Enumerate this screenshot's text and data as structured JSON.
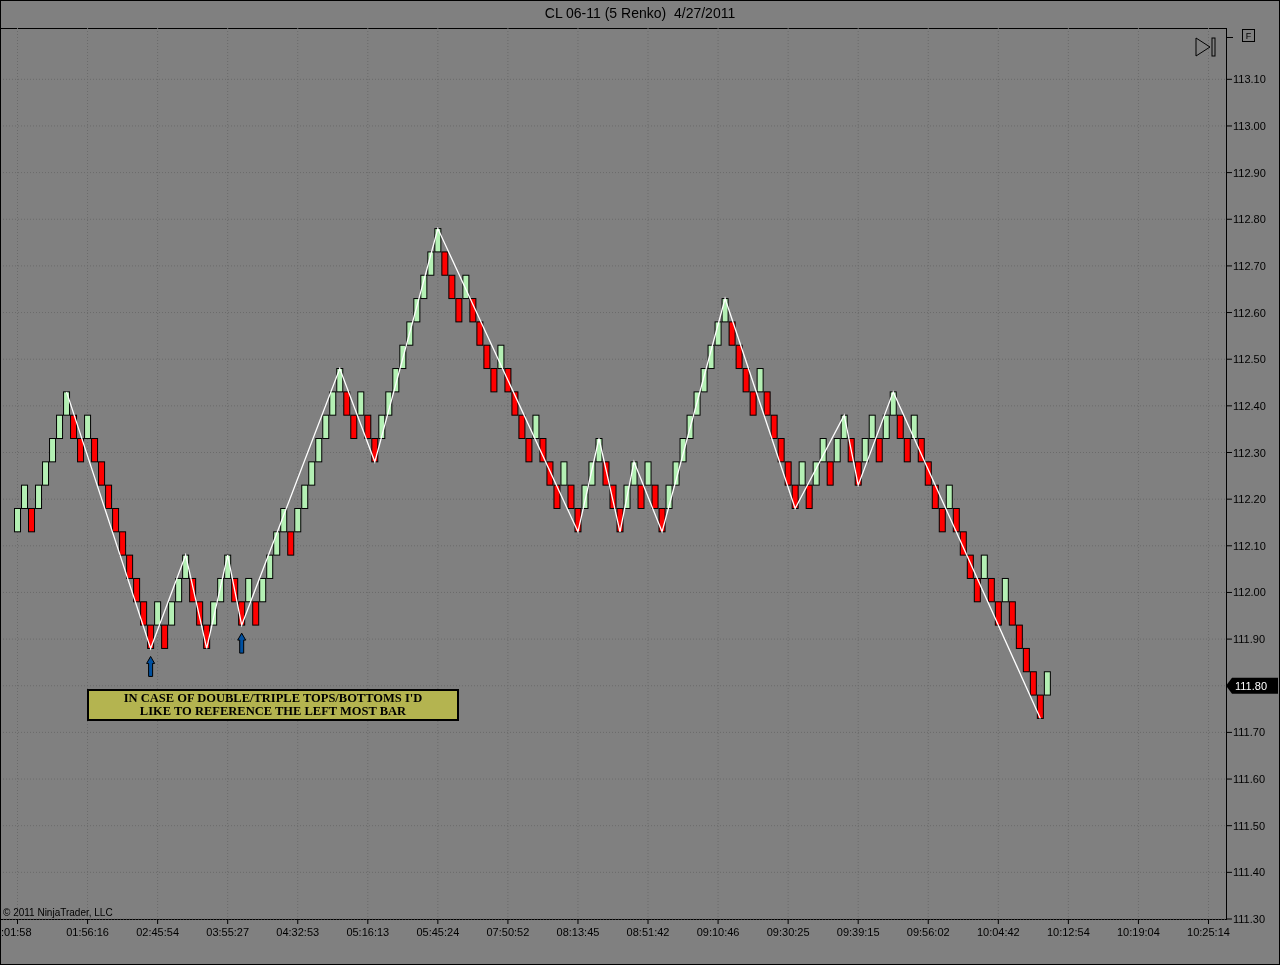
{
  "copyright": "© 2011 NinjaTrader, LLC",
  "toolbar": {
    "f_button": "F"
  },
  "note": "IN CASE OF DOUBLE/TRIPLE TOPS/BOTTOMS I'D LIKE TO REFERENCE THE LEFT MOST BAR",
  "last_price_label": "111.80",
  "renko_bricks": [
    {
      "kind": "gap"
    },
    {
      "kind": "gap"
    },
    {
      "kind": "up"
    },
    {
      "kind": "up"
    },
    {
      "kind": "down"
    },
    {
      "kind": "up"
    },
    {
      "kind": "up"
    },
    {
      "kind": "up"
    },
    {
      "kind": "up"
    },
    {
      "kind": "up"
    },
    {
      "kind": "down"
    },
    {
      "kind": "down"
    },
    {
      "kind": "up"
    },
    {
      "kind": "down"
    },
    {
      "kind": "down"
    },
    {
      "kind": "down"
    },
    {
      "kind": "down"
    },
    {
      "kind": "down"
    },
    {
      "kind": "down"
    },
    {
      "kind": "down"
    },
    {
      "kind": "down"
    },
    {
      "kind": "down"
    },
    {
      "kind": "up"
    },
    {
      "kind": "down"
    },
    {
      "kind": "up"
    },
    {
      "kind": "up"
    },
    {
      "kind": "up"
    },
    {
      "kind": "down"
    },
    {
      "kind": "down"
    },
    {
      "kind": "down"
    },
    {
      "kind": "up"
    },
    {
      "kind": "up"
    },
    {
      "kind": "up"
    },
    {
      "kind": "down"
    },
    {
      "kind": "down"
    },
    {
      "kind": "up"
    },
    {
      "kind": "down"
    },
    {
      "kind": "up"
    },
    {
      "kind": "up"
    },
    {
      "kind": "up"
    },
    {
      "kind": "up"
    },
    {
      "kind": "down"
    },
    {
      "kind": "up"
    },
    {
      "kind": "up"
    },
    {
      "kind": "up"
    },
    {
      "kind": "up"
    },
    {
      "kind": "up"
    },
    {
      "kind": "up"
    },
    {
      "kind": "up"
    },
    {
      "kind": "down"
    },
    {
      "kind": "down"
    },
    {
      "kind": "up"
    },
    {
      "kind": "down"
    },
    {
      "kind": "down"
    },
    {
      "kind": "up"
    },
    {
      "kind": "up"
    },
    {
      "kind": "up"
    },
    {
      "kind": "up"
    },
    {
      "kind": "up"
    },
    {
      "kind": "up"
    },
    {
      "kind": "up"
    },
    {
      "kind": "up"
    },
    {
      "kind": "up"
    },
    {
      "kind": "down"
    },
    {
      "kind": "down"
    },
    {
      "kind": "down"
    },
    {
      "kind": "up"
    },
    {
      "kind": "down"
    },
    {
      "kind": "down"
    },
    {
      "kind": "down"
    },
    {
      "kind": "down"
    },
    {
      "kind": "up"
    },
    {
      "kind": "down"
    },
    {
      "kind": "down"
    },
    {
      "kind": "down"
    },
    {
      "kind": "down"
    },
    {
      "kind": "up"
    },
    {
      "kind": "down"
    },
    {
      "kind": "down"
    },
    {
      "kind": "down"
    },
    {
      "kind": "up"
    },
    {
      "kind": "down"
    },
    {
      "kind": "down"
    },
    {
      "kind": "up"
    },
    {
      "kind": "up"
    },
    {
      "kind": "up"
    },
    {
      "kind": "down"
    },
    {
      "kind": "down"
    },
    {
      "kind": "down"
    },
    {
      "kind": "up"
    },
    {
      "kind": "up"
    },
    {
      "kind": "down"
    },
    {
      "kind": "up"
    },
    {
      "kind": "down"
    },
    {
      "kind": "down"
    },
    {
      "kind": "up"
    },
    {
      "kind": "up"
    },
    {
      "kind": "up"
    },
    {
      "kind": "up"
    },
    {
      "kind": "up"
    },
    {
      "kind": "up"
    },
    {
      "kind": "up"
    },
    {
      "kind": "up"
    },
    {
      "kind": "up"
    },
    {
      "kind": "down"
    },
    {
      "kind": "down"
    },
    {
      "kind": "down"
    },
    {
      "kind": "down"
    },
    {
      "kind": "up"
    },
    {
      "kind": "down"
    },
    {
      "kind": "down"
    },
    {
      "kind": "down"
    },
    {
      "kind": "down"
    },
    {
      "kind": "down"
    },
    {
      "kind": "up"
    },
    {
      "kind": "down"
    },
    {
      "kind": "up"
    },
    {
      "kind": "up"
    },
    {
      "kind": "down"
    },
    {
      "kind": "up"
    },
    {
      "kind": "up"
    },
    {
      "kind": "down"
    },
    {
      "kind": "down"
    },
    {
      "kind": "up"
    },
    {
      "kind": "up"
    },
    {
      "kind": "down"
    },
    {
      "kind": "up"
    },
    {
      "kind": "up"
    },
    {
      "kind": "down"
    },
    {
      "kind": "down"
    },
    {
      "kind": "up"
    },
    {
      "kind": "down"
    },
    {
      "kind": "down"
    },
    {
      "kind": "down"
    },
    {
      "kind": "down"
    },
    {
      "kind": "up"
    },
    {
      "kind": "down"
    },
    {
      "kind": "down"
    },
    {
      "kind": "down"
    },
    {
      "kind": "down"
    },
    {
      "kind": "up"
    },
    {
      "kind": "down"
    },
    {
      "kind": "down"
    },
    {
      "kind": "up"
    },
    {
      "kind": "down"
    },
    {
      "kind": "down"
    },
    {
      "kind": "down"
    },
    {
      "kind": "down"
    },
    {
      "kind": "down"
    },
    {
      "kind": "up"
    }
  ],
  "chart": {
    "chart_data": {
      "type": "line",
      "title": "CL 06-11 (5 Renko)  4/27/2011",
      "categories": [
        null,
        null,
        ":01:58",
        null,
        null,
        null,
        null,
        null,
        null,
        null,
        null,
        null,
        "01:56:16",
        null,
        null,
        null,
        null,
        null,
        null,
        null,
        null,
        null,
        "02:45:54",
        null,
        null,
        null,
        null,
        null,
        null,
        null,
        null,
        null,
        "03:55:27",
        null,
        null,
        null,
        null,
        null,
        null,
        null,
        null,
        null,
        "04:32:53",
        null,
        null,
        null,
        null,
        null,
        null,
        null,
        null,
        null,
        "05:16:13",
        null,
        null,
        null,
        null,
        null,
        null,
        null,
        null,
        null,
        "05:45:24",
        null,
        null,
        null,
        null,
        null,
        null,
        null,
        null,
        null,
        "07:50:52",
        null,
        null,
        null,
        null,
        null,
        null,
        null,
        null,
        null,
        "08:13:45",
        null,
        null,
        null,
        null,
        null,
        null,
        null,
        null,
        null,
        "08:51:42",
        null,
        null,
        null,
        null,
        null,
        null,
        null,
        null,
        null,
        "09:10:46",
        null,
        null,
        null,
        null,
        null,
        null,
        null,
        null,
        null,
        "09:30:25",
        null,
        null,
        null,
        null,
        null,
        null,
        null,
        null,
        null,
        "09:39:15",
        null,
        null,
        null,
        null,
        null,
        null,
        null,
        null,
        null,
        "09:56:02",
        null,
        null,
        null,
        null,
        null,
        null,
        null,
        null,
        null,
        "10:04:42",
        null,
        null,
        null,
        null,
        null,
        null,
        null,
        null,
        null,
        "10:12:54",
        null,
        null,
        null,
        null,
        null,
        null,
        null,
        null,
        null,
        "10:19:04",
        null,
        null,
        null,
        null,
        null,
        null,
        null,
        null,
        null,
        "10:25:14",
        null,
        null
      ],
      "series": [
        {
          "color": "#ffffff",
          "values": [
            null,
            null,
            null,
            null,
            null,
            null,
            null,
            null,
            null,
            112.43,
            null,
            null,
            null,
            null,
            null,
            null,
            null,
            null,
            null,
            null,
            null,
            111.88,
            null,
            null,
            null,
            null,
            112.08,
            null,
            null,
            111.88,
            null,
            null,
            112.08,
            null,
            111.93,
            null,
            null,
            null,
            null,
            null,
            null,
            null,
            null,
            null,
            null,
            null,
            null,
            null,
            112.48,
            null,
            null,
            null,
            null,
            112.28,
            null,
            null,
            null,
            null,
            null,
            null,
            null,
            null,
            112.78,
            null,
            null,
            null,
            null,
            null,
            null,
            null,
            null,
            null,
            null,
            null,
            null,
            null,
            null,
            null,
            null,
            null,
            null,
            null,
            112.13,
            null,
            null,
            112.33,
            null,
            null,
            112.13,
            null,
            112.28,
            null,
            null,
            null,
            112.13,
            null,
            null,
            null,
            null,
            null,
            null,
            null,
            null,
            112.63,
            null,
            null,
            null,
            null,
            null,
            null,
            null,
            null,
            null,
            112.18,
            null,
            null,
            null,
            null,
            null,
            null,
            112.38,
            null,
            112.23,
            null,
            null,
            null,
            null,
            112.43,
            null,
            null,
            null,
            null,
            null,
            null,
            null,
            null,
            null,
            null,
            null,
            null,
            null,
            null,
            null,
            null,
            null,
            null,
            null,
            null,
            111.73,
            null,
            null,
            null,
            null,
            null,
            null,
            null,
            null,
            null,
            null,
            null,
            null,
            null,
            null,
            null,
            null,
            null,
            null,
            null,
            null,
            null,
            null,
            null,
            null,
            null,
            null
          ]
        }
      ],
      "ylim": [
        111.3,
        113.21
      ],
      "grid": true,
      "yticks": [
        {
          "value": 111.3,
          "label": "111.30"
        },
        {
          "value": 111.4,
          "label": "111.40"
        },
        {
          "value": 111.5,
          "label": "111.50"
        },
        {
          "value": 111.6,
          "label": "111.60"
        },
        {
          "value": 111.7,
          "label": "111.70"
        },
        {
          "value": 111.8,
          "label": "111.80"
        },
        {
          "value": 111.9,
          "label": "111.90"
        },
        {
          "value": 112.0,
          "label": "112.00"
        },
        {
          "value": 112.1,
          "label": "112.10"
        },
        {
          "value": 112.2,
          "label": "112.20"
        },
        {
          "value": 112.3,
          "label": "112.30"
        },
        {
          "value": 112.4,
          "label": "112.40"
        },
        {
          "value": 112.5,
          "label": "112.50"
        },
        {
          "value": 112.6,
          "label": "112.60"
        },
        {
          "value": 112.7,
          "label": "112.70"
        },
        {
          "value": 112.8,
          "label": "112.80"
        },
        {
          "value": 112.9,
          "label": "112.90"
        },
        {
          "value": 113.0,
          "label": "113.00"
        },
        {
          "value": 113.1,
          "label": "113.10"
        }
      ]
    }
  }
}
